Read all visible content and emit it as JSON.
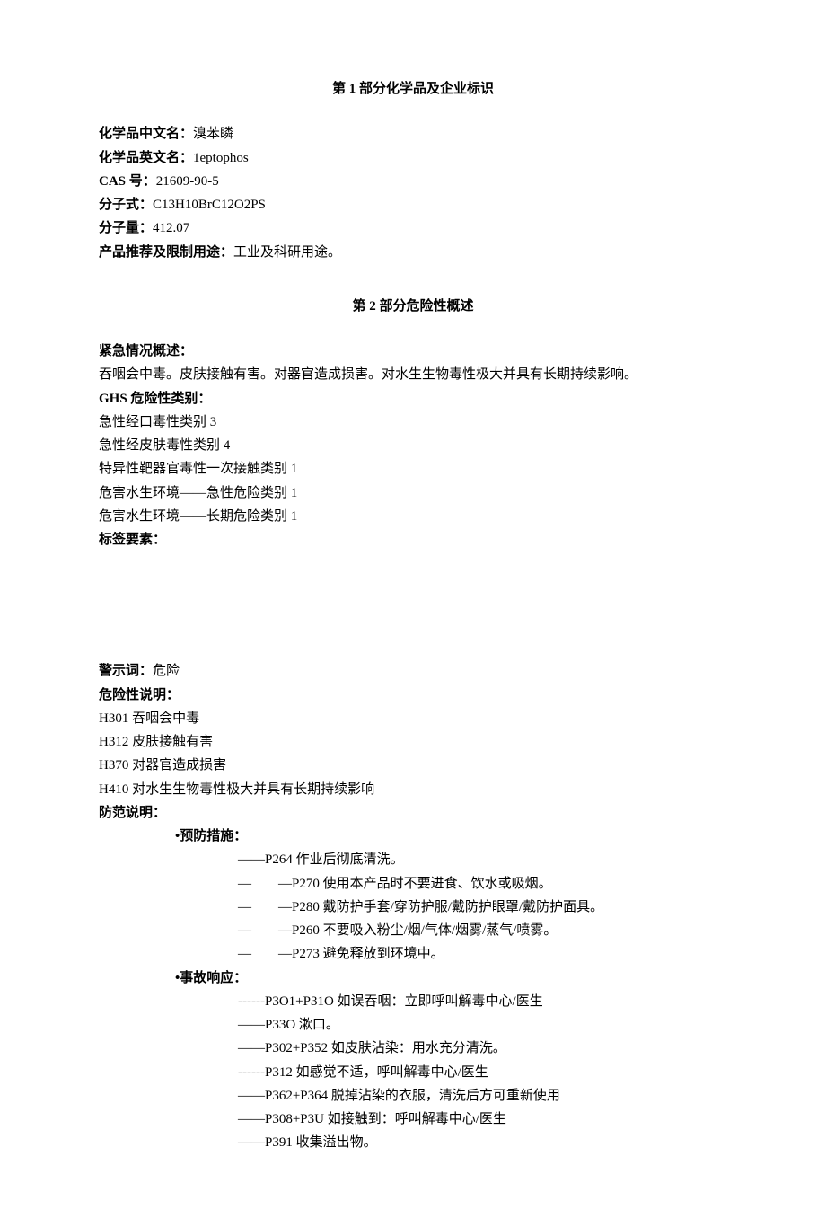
{
  "section1": {
    "title": "第 1 部分化学品及企业标识",
    "chineseNameLabel": "化学品中文名：",
    "chineseName": "溴苯瞵",
    "englishNameLabel": "化学品英文名：",
    "englishName": "1eptophos",
    "casLabel": "CAS 号：",
    "cas": "21609-90-5",
    "formulaLabel": "分子式：",
    "formula": "C13H10BrC12O2PS",
    "weightLabel": "分子量：",
    "weight": "412.07",
    "usageLabel": "产品推荐及限制用途：",
    "usage": "工业及科研用途。"
  },
  "section2": {
    "title": "第 2 部分危险性概述",
    "emergencyLabel": "紧急情况概述：",
    "emergencyText": "吞咽会中毒。皮肤接触有害。对器官造成损害。对水生生物毒性极大并具有长期持续影响。",
    "ghsLabel": "GHS 危险性类别：",
    "ghs1": "急性经口毒性类别 3",
    "ghs2": "急性经皮肤毒性类别 4",
    "ghs3": "特异性靶器官毒性一次接触类别 1",
    "ghs4": "危害水生环境——急性危险类别 1",
    "ghs5": "危害水生环境——长期危险类别 1",
    "labelElementsLabel": "标签要素：",
    "signalWordLabel": "警示词：",
    "signalWord": "危险",
    "hazardLabel": "危险性说明：",
    "h1": "H301 吞咽会中毒",
    "h2": "H312 皮肤接触有害",
    "h3": "H370 对器官造成损害",
    "h4": "H410 对水生生物毒性极大并具有长期持续影响",
    "precautionLabel": "防范说明：",
    "preventLabel": "•预防措施：",
    "p264": "——P264 作业后彻底清洗。",
    "p270": "—　　—P270 使用本产品时不要进食、饮水或吸烟。",
    "p280": "—　　—P280 戴防护手套/穿防护服/戴防护眼罩/戴防护面具。",
    "p260": "—　　—P260 不要吸入粉尘/烟/气体/烟雾/蒸气/喷雾。",
    "p273": "—　　—P273 避免释放到环境中。",
    "responseLabel": "•事故响应：",
    "p301": "------P3O1+P31O 如误吞咽：立即呼叫解毒中心/医生",
    "p330": "——P33O 漱口。",
    "p302": "——P302+P352 如皮肤沾染：用水充分清洗。",
    "p312": "------P312 如感觉不适，呼叫解毒中心/医生",
    "p362": "——P362+P364 脱掉沾染的衣服，清洗后方可重新使用",
    "p308": "——P308+P3U 如接触到：呼叫解毒中心/医生",
    "p391": "——P391 收集溢出物。"
  }
}
